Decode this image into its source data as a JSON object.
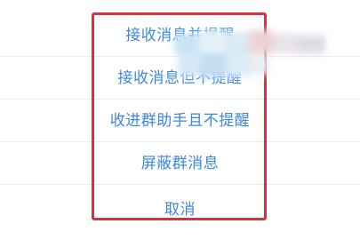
{
  "action_sheet": {
    "items": [
      {
        "label": "接收消息并提醒"
      },
      {
        "label": "接收消息但不提醒"
      },
      {
        "label": "收进群助手且不提醒"
      },
      {
        "label": "屏蔽群消息"
      },
      {
        "label": "取消"
      }
    ]
  },
  "colors": {
    "item_text": "#3e87e0",
    "highlight_frame": "#d3343f",
    "separator": "#ececec"
  }
}
